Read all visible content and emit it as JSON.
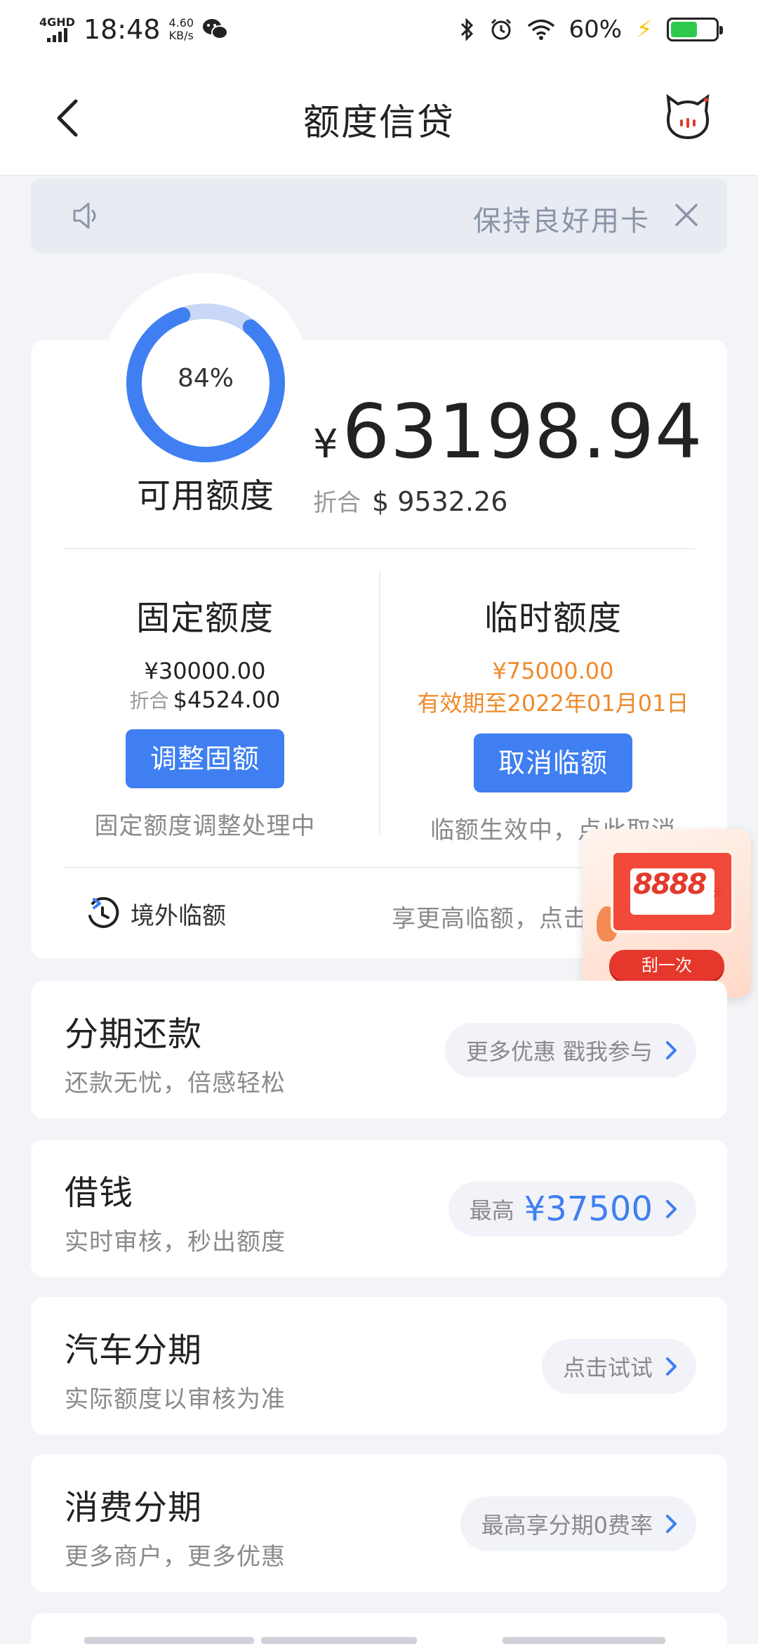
{
  "status_bar": {
    "network": "4GHD",
    "time": "18:48",
    "speed_value": "4.60",
    "speed_unit": "KB/s",
    "battery": "60%",
    "battery_level": 0.6
  },
  "nav": {
    "title": "额度信贷"
  },
  "notice": {
    "text": "保持良好用卡"
  },
  "credit": {
    "percent_label": "84%",
    "percent_value": 0.84,
    "available_label": "可用额度",
    "currency_symbol": "¥",
    "available_amount": "63198.94",
    "converted_label": "折合",
    "converted_amount": "$ 9532.26",
    "fixed": {
      "title": "固定额度",
      "amount": "¥30000.00",
      "converted_label": "折合",
      "converted_amount": "$4524.00",
      "button": "调整固额",
      "note": "固定额度调整处理中"
    },
    "temporary": {
      "title": "临时额度",
      "amount": "¥75000.00",
      "validity": "有效期至2022年01月01日",
      "button": "取消临额",
      "note": "临额生效中，点此取消"
    },
    "overseas_label": "境外临额",
    "overseas_tip": "享更高临额，点击"
  },
  "promo": {
    "amount": "8888",
    "unit": "元",
    "button": "刮一次"
  },
  "services": [
    {
      "title": "分期还款",
      "subtitle": "还款无忧，倍感轻松",
      "pill_text": "更多优惠 戳我参与",
      "pill_big": ""
    },
    {
      "title": "借钱",
      "subtitle": "实时审核，秒出额度",
      "pill_text": "最高",
      "pill_big": "¥37500"
    },
    {
      "title": "汽车分期",
      "subtitle": "实际额度以审核为准",
      "pill_text": "点击试试",
      "pill_big": ""
    },
    {
      "title": "消费分期",
      "subtitle": "更多商户，更多优惠",
      "pill_text": "最高享分期0费率",
      "pill_big": ""
    }
  ],
  "colors": {
    "accent": "#3f7ff1",
    "orange": "#ef8a2a",
    "gauge_track": "#c9d8f6"
  }
}
